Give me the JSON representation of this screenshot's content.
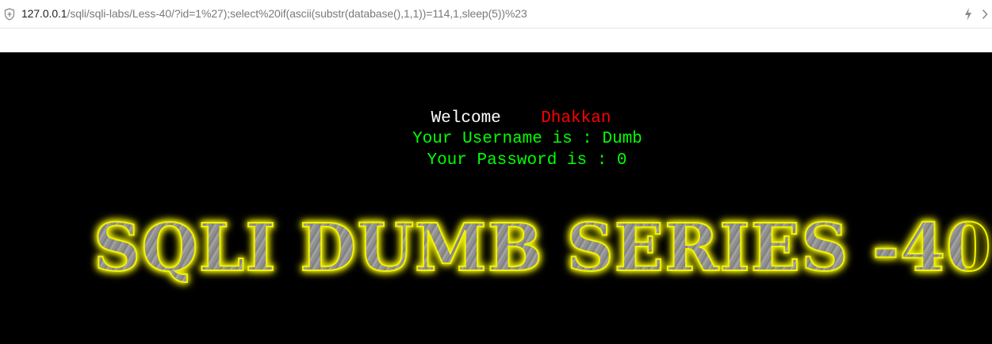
{
  "browser": {
    "url_host": "127.0.0.1",
    "url_rest": "/sqli/sqli-labs/Less-40/?id=1%27);select%20if(ascii(substr(database(),1,1))=114,1,sleep(5))%23",
    "icons": [
      "shield-icon",
      "lightning-icon",
      "chevron-right-icon"
    ]
  },
  "page": {
    "welcome_label": "Welcome",
    "welcome_name": "Dhakkan",
    "username_line": "Your Username is : Dumb",
    "password_line": "Your Password is : 0",
    "banner": "SQLI DUMB SERIES -40"
  },
  "colors": {
    "page_bg": "#000000",
    "welcome": "#ffffff",
    "name": "#ff0000",
    "credentials": "#00ff00",
    "banner_glow": "#f4f400"
  }
}
